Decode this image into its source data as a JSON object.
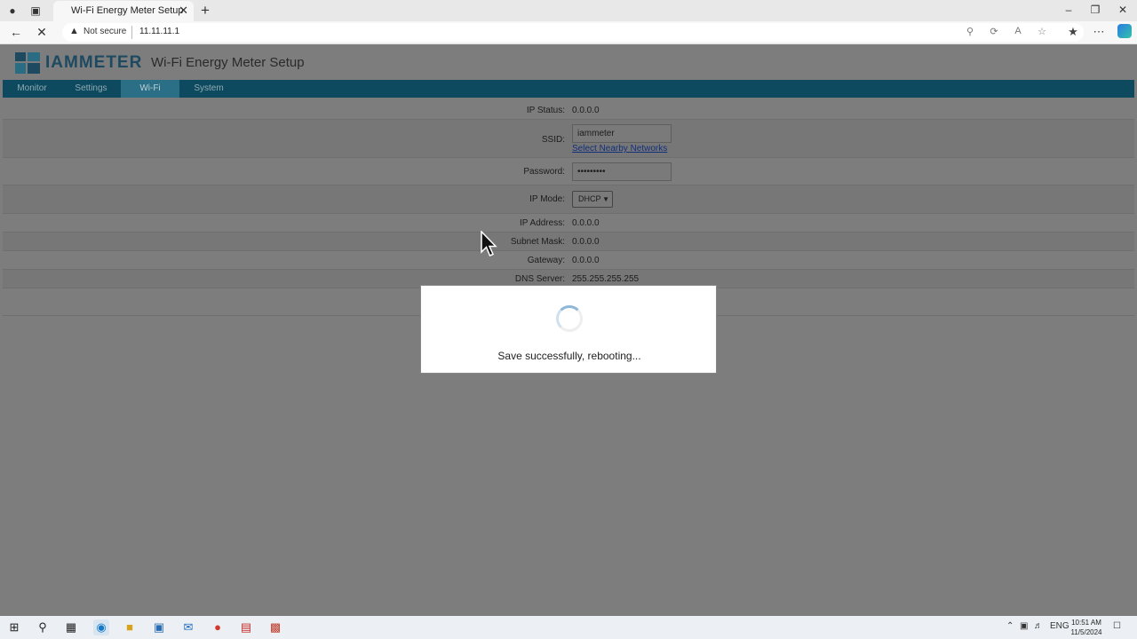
{
  "browser": {
    "tab_title": "Wi-Fi Energy Meter Setup",
    "security_label": "Not secure",
    "url": "11.11.11.1"
  },
  "header": {
    "logo_text": "IAMMETER",
    "title": "Wi-Fi Energy Meter Setup"
  },
  "nav": {
    "tabs": [
      {
        "label": "Monitor"
      },
      {
        "label": "Settings"
      },
      {
        "label": "Wi-Fi"
      },
      {
        "label": "System"
      }
    ],
    "active_tab": "Wi-Fi"
  },
  "form": {
    "ip_status_label": "IP Status:",
    "ip_status_value": "0.0.0.0",
    "ssid_label": "SSID:",
    "ssid_value": "iammeter",
    "nearby_link": "Select Nearby Networks",
    "password_label": "Password:",
    "password_value": "•••••••••",
    "ip_mode_label": "IP Mode:",
    "ip_mode_value": "DHCP",
    "ip_address_label": "IP Address:",
    "ip_address_value": "0.0.0.0",
    "subnet_label": "Subnet Mask:",
    "subnet_value": "0.0.0.0",
    "gateway_label": "Gateway:",
    "gateway_value": "0.0.0.0",
    "dns_label": "DNS Server:",
    "dns_value": "255.255.255.255"
  },
  "modal": {
    "message": "Save successfully, rebooting..."
  },
  "taskbar": {
    "language": "ENG",
    "time": "10:51 AM",
    "date": "11/5/2024"
  },
  "colors": {
    "nav_bg": "#0e4a5f",
    "nav_active": "#2a6f86",
    "overlay_page": "#7d7d7d",
    "link": "#112f7a"
  }
}
